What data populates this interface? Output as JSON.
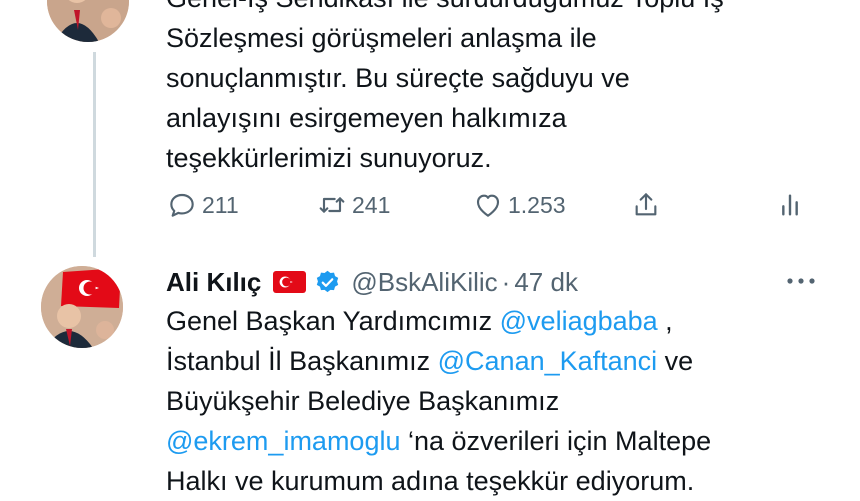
{
  "top_tweet": {
    "text_lines": [
      "Genel-İş Sendikası ile sürdürdüğümüz Toplu İş",
      "Sözleşmesi görüşmeleri anlaşma ile",
      "sonuçlanmıştır. Bu süreçte sağduyu ve",
      "anlayışını esirgemeyen halkımıza",
      "teşekkürlerimizi sunuyoruz."
    ],
    "actions": {
      "replies": "211",
      "retweets": "241",
      "likes": "1.253"
    }
  },
  "reply_tweet": {
    "author_name": "Ali Kılıç",
    "handle": "@BskAliKilic",
    "separator": "·",
    "time": "47 dk",
    "body": {
      "l1_a": "Genel Başkan Yardımcımız ",
      "l1_m": "@veliagbaba",
      "l1_b": " ,",
      "l2_a": "İstanbul İl Başkanımız ",
      "l2_m": "@Canan_Kaftanci",
      "l2_b": " ve",
      "l3_a": "Büyükşehir Belediye Başkanımız",
      "l4_m": "@ekrem_imamoglu",
      "l4_b": " ‘na özverileri için Maltepe",
      "l5_a": "Halkı ve kurumum adına teşekkür ediyorum."
    }
  },
  "icons": {
    "reply": "comment-icon",
    "retweet": "retweet-icon",
    "like": "heart-icon",
    "share": "share-icon",
    "analytics": "analytics-icon",
    "verified": "verified-badge-icon",
    "flag": "turkey-flag-icon",
    "more": "more-dots-icon"
  },
  "colors": {
    "mention": "#1d9bf0",
    "secondary_text": "#536471",
    "verified": "#1d9bf0",
    "flag_red": "#e30a17"
  }
}
